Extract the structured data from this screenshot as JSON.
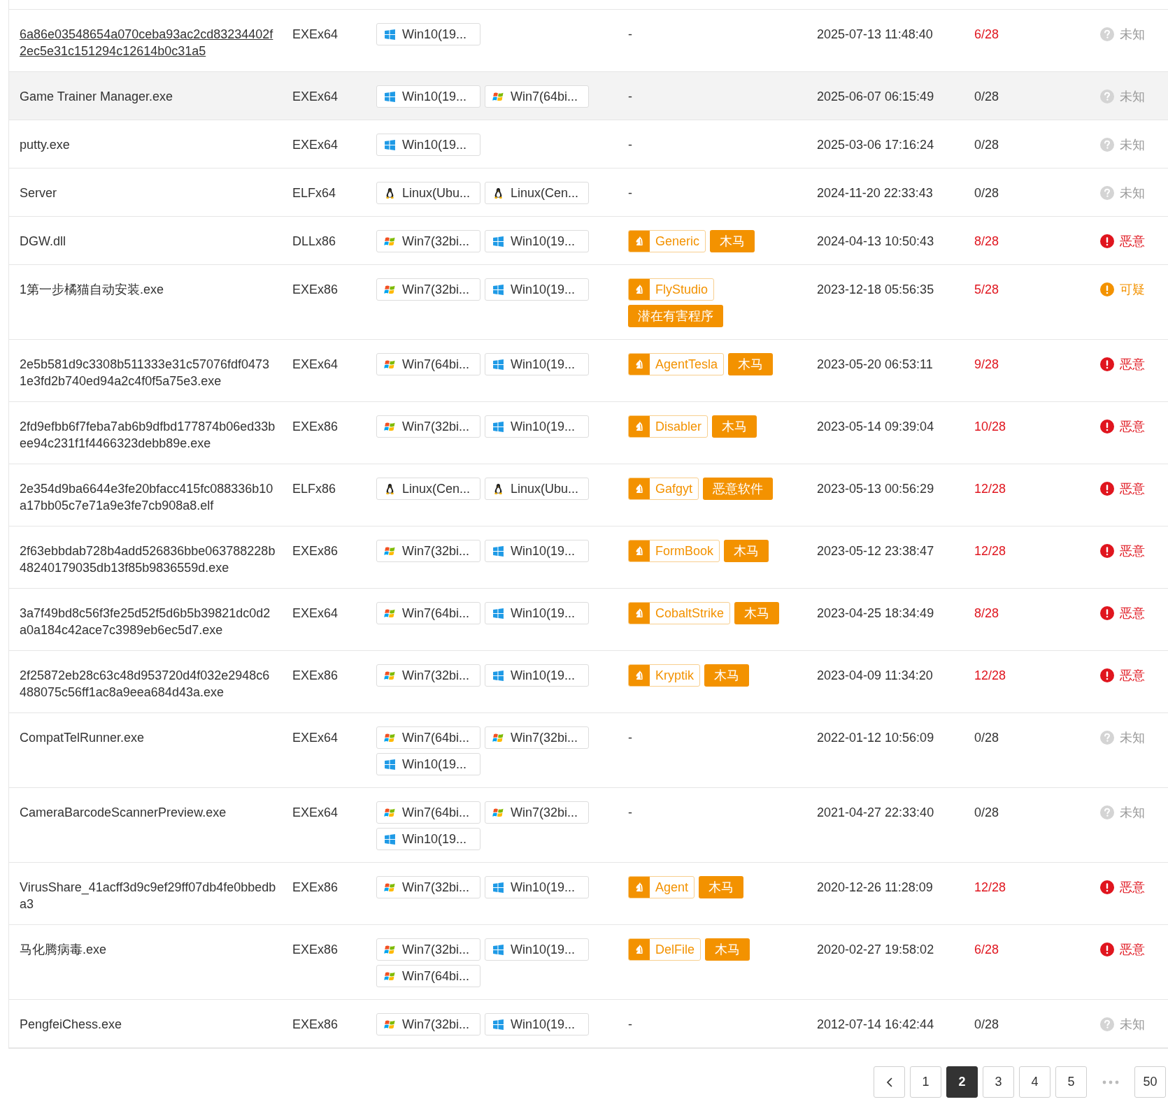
{
  "rows": [
    {
      "name": "6a86e03548654a070ceba93ac2cd83234402f2ec5e31c151294c12614b0c31a5",
      "name_underlined": true,
      "highlighted": false,
      "type": "EXEx64",
      "envs": [
        {
          "kind": "win10",
          "label": "Win10(19..."
        }
      ],
      "dash": "-",
      "date": "2025-07-13 11:48:40",
      "score": "6/28",
      "score_flagged": true,
      "verdict": {
        "kind": "unknown",
        "label": "未知"
      }
    },
    {
      "name": "Game Trainer Manager.exe",
      "name_underlined": false,
      "highlighted": true,
      "type": "EXEx64",
      "envs": [
        {
          "kind": "win10",
          "label": "Win10(19..."
        },
        {
          "kind": "win7",
          "label": "Win7(64bi..."
        }
      ],
      "dash": "-",
      "date": "2025-06-07 06:15:49",
      "score": "0/28",
      "score_flagged": false,
      "verdict": {
        "kind": "unknown",
        "label": "未知"
      }
    },
    {
      "name": "putty.exe",
      "name_underlined": false,
      "highlighted": false,
      "type": "EXEx64",
      "envs": [
        {
          "kind": "win10",
          "label": "Win10(19..."
        }
      ],
      "dash": "-",
      "date": "2025-03-06 17:16:24",
      "score": "0/28",
      "score_flagged": false,
      "verdict": {
        "kind": "unknown",
        "label": "未知"
      }
    },
    {
      "name": "Server",
      "name_underlined": false,
      "highlighted": false,
      "type": "ELFx64",
      "envs": [
        {
          "kind": "linux",
          "label": "Linux(Ubu..."
        },
        {
          "kind": "linux",
          "label": "Linux(Cen..."
        }
      ],
      "dash": "-",
      "date": "2024-11-20 22:33:43",
      "score": "0/28",
      "score_flagged": false,
      "verdict": {
        "kind": "unknown",
        "label": "未知"
      }
    },
    {
      "name": "DGW.dll",
      "name_underlined": false,
      "highlighted": false,
      "type": "DLLx86",
      "envs": [
        {
          "kind": "win7",
          "label": "Win7(32bi..."
        },
        {
          "kind": "win10",
          "label": "Win10(19..."
        }
      ],
      "tags": [
        {
          "kind": "family",
          "label": "Generic"
        },
        {
          "kind": "category",
          "label": "木马"
        }
      ],
      "date": "2024-04-13 10:50:43",
      "score": "8/28",
      "score_flagged": true,
      "verdict": {
        "kind": "malicious",
        "label": "恶意"
      }
    },
    {
      "name": "1第一步橘猫自动安装.exe",
      "name_underlined": false,
      "highlighted": false,
      "type": "EXEx86",
      "envs": [
        {
          "kind": "win7",
          "label": "Win7(32bi..."
        },
        {
          "kind": "win10",
          "label": "Win10(19..."
        }
      ],
      "tags": [
        {
          "kind": "family",
          "label": "FlyStudio"
        },
        {
          "kind": "category",
          "label": "潜在有害程序"
        }
      ],
      "date": "2023-12-18 05:56:35",
      "score": "5/28",
      "score_flagged": true,
      "verdict": {
        "kind": "suspicious",
        "label": "可疑"
      }
    },
    {
      "name": "2e5b581d9c3308b511333e31c57076fdf04731e3fd2b740ed94a2c4f0f5a75e3.exe",
      "name_underlined": false,
      "highlighted": false,
      "type": "EXEx64",
      "envs": [
        {
          "kind": "win7",
          "label": "Win7(64bi..."
        },
        {
          "kind": "win10",
          "label": "Win10(19..."
        }
      ],
      "tags": [
        {
          "kind": "family",
          "label": "AgentTesla"
        },
        {
          "kind": "category",
          "label": "木马"
        }
      ],
      "date": "2023-05-20 06:53:11",
      "score": "9/28",
      "score_flagged": true,
      "verdict": {
        "kind": "malicious",
        "label": "恶意"
      }
    },
    {
      "name": "2fd9efbb6f7feba7ab6b9dfbd177874b06ed33bee94c231f1f4466323debb89e.exe",
      "name_underlined": false,
      "highlighted": false,
      "type": "EXEx86",
      "envs": [
        {
          "kind": "win7",
          "label": "Win7(32bi..."
        },
        {
          "kind": "win10",
          "label": "Win10(19..."
        }
      ],
      "tags": [
        {
          "kind": "family",
          "label": "Disabler"
        },
        {
          "kind": "category",
          "label": "木马"
        }
      ],
      "date": "2023-05-14 09:39:04",
      "score": "10/28",
      "score_flagged": true,
      "verdict": {
        "kind": "malicious",
        "label": "恶意"
      }
    },
    {
      "name": "2e354d9ba6644e3fe20bfacc415fc088336b10a17bb05c7e71a9e3fe7cb908a8.elf",
      "name_underlined": false,
      "highlighted": false,
      "type": "ELFx86",
      "envs": [
        {
          "kind": "linux",
          "label": "Linux(Cen..."
        },
        {
          "kind": "linux",
          "label": "Linux(Ubu..."
        }
      ],
      "tags": [
        {
          "kind": "family",
          "label": "Gafgyt"
        },
        {
          "kind": "category",
          "label": "恶意软件"
        }
      ],
      "date": "2023-05-13 00:56:29",
      "score": "12/28",
      "score_flagged": true,
      "verdict": {
        "kind": "malicious",
        "label": "恶意"
      }
    },
    {
      "name": "2f63ebbdab728b4add526836bbe063788228b48240179035db13f85b9836559d.exe",
      "name_underlined": false,
      "highlighted": false,
      "type": "EXEx86",
      "envs": [
        {
          "kind": "win7",
          "label": "Win7(32bi..."
        },
        {
          "kind": "win10",
          "label": "Win10(19..."
        }
      ],
      "tags": [
        {
          "kind": "family",
          "label": "FormBook"
        },
        {
          "kind": "category",
          "label": "木马"
        }
      ],
      "date": "2023-05-12 23:38:47",
      "score": "12/28",
      "score_flagged": true,
      "verdict": {
        "kind": "malicious",
        "label": "恶意"
      }
    },
    {
      "name": "3a7f49bd8c56f3fe25d52f5d6b5b39821dc0d2a0a184c42ace7c3989eb6ec5d7.exe",
      "name_underlined": false,
      "highlighted": false,
      "type": "EXEx64",
      "envs": [
        {
          "kind": "win7",
          "label": "Win7(64bi..."
        },
        {
          "kind": "win10",
          "label": "Win10(19..."
        }
      ],
      "tags": [
        {
          "kind": "family",
          "label": "CobaltStrike"
        },
        {
          "kind": "category",
          "label": "木马"
        }
      ],
      "date": "2023-04-25 18:34:49",
      "score": "8/28",
      "score_flagged": true,
      "verdict": {
        "kind": "malicious",
        "label": "恶意"
      }
    },
    {
      "name": "2f25872eb28c63c48d953720d4f032e2948c6488075c56ff1ac8a9eea684d43a.exe",
      "name_underlined": false,
      "highlighted": false,
      "type": "EXEx86",
      "envs": [
        {
          "kind": "win7",
          "label": "Win7(32bi..."
        },
        {
          "kind": "win10",
          "label": "Win10(19..."
        }
      ],
      "tags": [
        {
          "kind": "family",
          "label": "Kryptik"
        },
        {
          "kind": "category",
          "label": "木马"
        }
      ],
      "date": "2023-04-09 11:34:20",
      "score": "12/28",
      "score_flagged": true,
      "verdict": {
        "kind": "malicious",
        "label": "恶意"
      }
    },
    {
      "name": "CompatTelRunner.exe",
      "name_underlined": false,
      "highlighted": false,
      "type": "EXEx64",
      "envs": [
        {
          "kind": "win7",
          "label": "Win7(64bi..."
        },
        {
          "kind": "win7",
          "label": "Win7(32bi..."
        },
        {
          "kind": "win10",
          "label": "Win10(19..."
        }
      ],
      "dash": "-",
      "date": "2022-01-12 10:56:09",
      "score": "0/28",
      "score_flagged": false,
      "verdict": {
        "kind": "unknown",
        "label": "未知"
      }
    },
    {
      "name": "CameraBarcodeScannerPreview.exe",
      "name_underlined": false,
      "highlighted": false,
      "type": "EXEx64",
      "envs": [
        {
          "kind": "win7",
          "label": "Win7(64bi..."
        },
        {
          "kind": "win7",
          "label": "Win7(32bi..."
        },
        {
          "kind": "win10",
          "label": "Win10(19..."
        }
      ],
      "dash": "-",
      "date": "2021-04-27 22:33:40",
      "score": "0/28",
      "score_flagged": false,
      "verdict": {
        "kind": "unknown",
        "label": "未知"
      }
    },
    {
      "name": "VirusShare_41acff3d9c9ef29ff07db4fe0bbedba3",
      "name_underlined": false,
      "highlighted": false,
      "type": "EXEx86",
      "envs": [
        {
          "kind": "win7",
          "label": "Win7(32bi..."
        },
        {
          "kind": "win10",
          "label": "Win10(19..."
        }
      ],
      "tags": [
        {
          "kind": "family",
          "label": "Agent"
        },
        {
          "kind": "category",
          "label": "木马"
        }
      ],
      "date": "2020-12-26 11:28:09",
      "score": "12/28",
      "score_flagged": true,
      "verdict": {
        "kind": "malicious",
        "label": "恶意"
      }
    },
    {
      "name": "马化腾病毒.exe",
      "name_underlined": false,
      "highlighted": false,
      "type": "EXEx86",
      "envs": [
        {
          "kind": "win7",
          "label": "Win7(32bi..."
        },
        {
          "kind": "win10",
          "label": "Win10(19..."
        },
        {
          "kind": "win7",
          "label": "Win7(64bi..."
        }
      ],
      "tags": [
        {
          "kind": "family",
          "label": "DelFile"
        },
        {
          "kind": "category",
          "label": "木马"
        }
      ],
      "date": "2020-02-27 19:58:02",
      "score": "6/28",
      "score_flagged": true,
      "verdict": {
        "kind": "malicious",
        "label": "恶意"
      }
    },
    {
      "name": "PengfeiChess.exe",
      "name_underlined": false,
      "highlighted": false,
      "type": "EXEx86",
      "envs": [
        {
          "kind": "win7",
          "label": "Win7(32bi..."
        },
        {
          "kind": "win10",
          "label": "Win10(19..."
        }
      ],
      "dash": "-",
      "date": "2012-07-14 16:42:44",
      "score": "0/28",
      "score_flagged": false,
      "verdict": {
        "kind": "unknown",
        "label": "未知"
      }
    }
  ],
  "pagination": {
    "items": [
      {
        "kind": "prev"
      },
      {
        "kind": "page",
        "label": "1",
        "selected": false
      },
      {
        "kind": "page",
        "label": "2",
        "selected": true
      },
      {
        "kind": "page",
        "label": "3",
        "selected": false
      },
      {
        "kind": "page",
        "label": "4",
        "selected": false
      },
      {
        "kind": "page",
        "label": "5",
        "selected": false
      },
      {
        "kind": "ellipsis"
      },
      {
        "kind": "page",
        "label": "50",
        "selected": false
      }
    ]
  }
}
